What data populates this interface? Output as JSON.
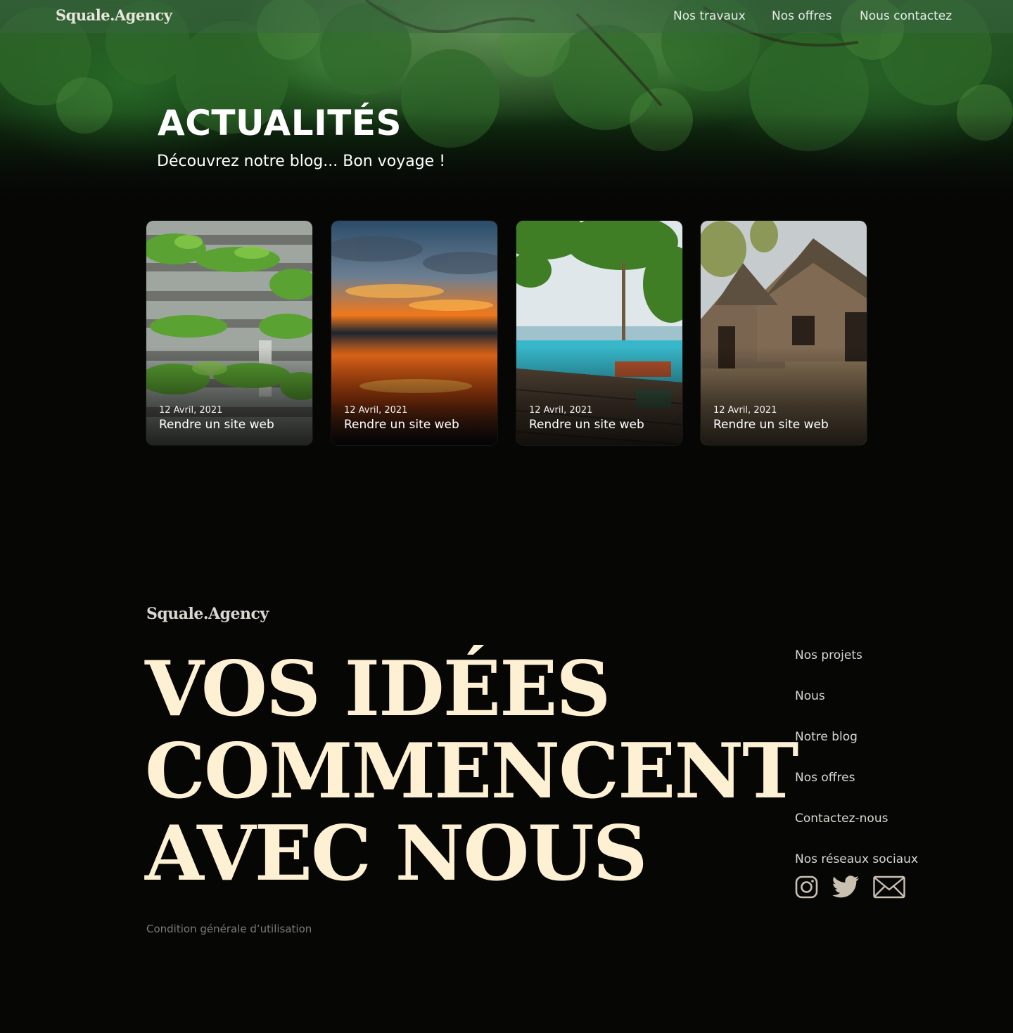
{
  "brand": {
    "name": "Squale.Agency"
  },
  "nav": {
    "items": [
      "Nos travaux",
      "Nos offres",
      "Nous contactez"
    ]
  },
  "hero": {
    "title": "ACTUALITÉS",
    "subtitle": "Découvrez notre blog... Bon voyage !"
  },
  "cards": [
    {
      "date": "12 Avril, 2021",
      "title": "Rendre un site web",
      "image": "green-building"
    },
    {
      "date": "12 Avril, 2021",
      "title": "Rendre un site web",
      "image": "sunset-lake"
    },
    {
      "date": "12 Avril, 2021",
      "title": "Rendre un site web",
      "image": "tropical-pool"
    },
    {
      "date": "12 Avril, 2021",
      "title": "Rendre un site web",
      "image": "mud-hut"
    }
  ],
  "footer": {
    "headline": [
      "VOS IDÉES",
      "COMMENCENT",
      "AVEC NOUS"
    ],
    "links": [
      "Nos projets",
      "Nous",
      "Notre blog",
      "Nos offres",
      "Contactez-nous",
      "Nos réseaux sociaux"
    ],
    "social": [
      "instagram-icon",
      "twitter-icon",
      "mail-icon"
    ],
    "legal": "Condition générale d’utilisation"
  },
  "colors": {
    "background": "#060605",
    "headline": "#fdf0d3",
    "footer_link": "#d9d7cf",
    "icon": "#c9c0b0"
  }
}
